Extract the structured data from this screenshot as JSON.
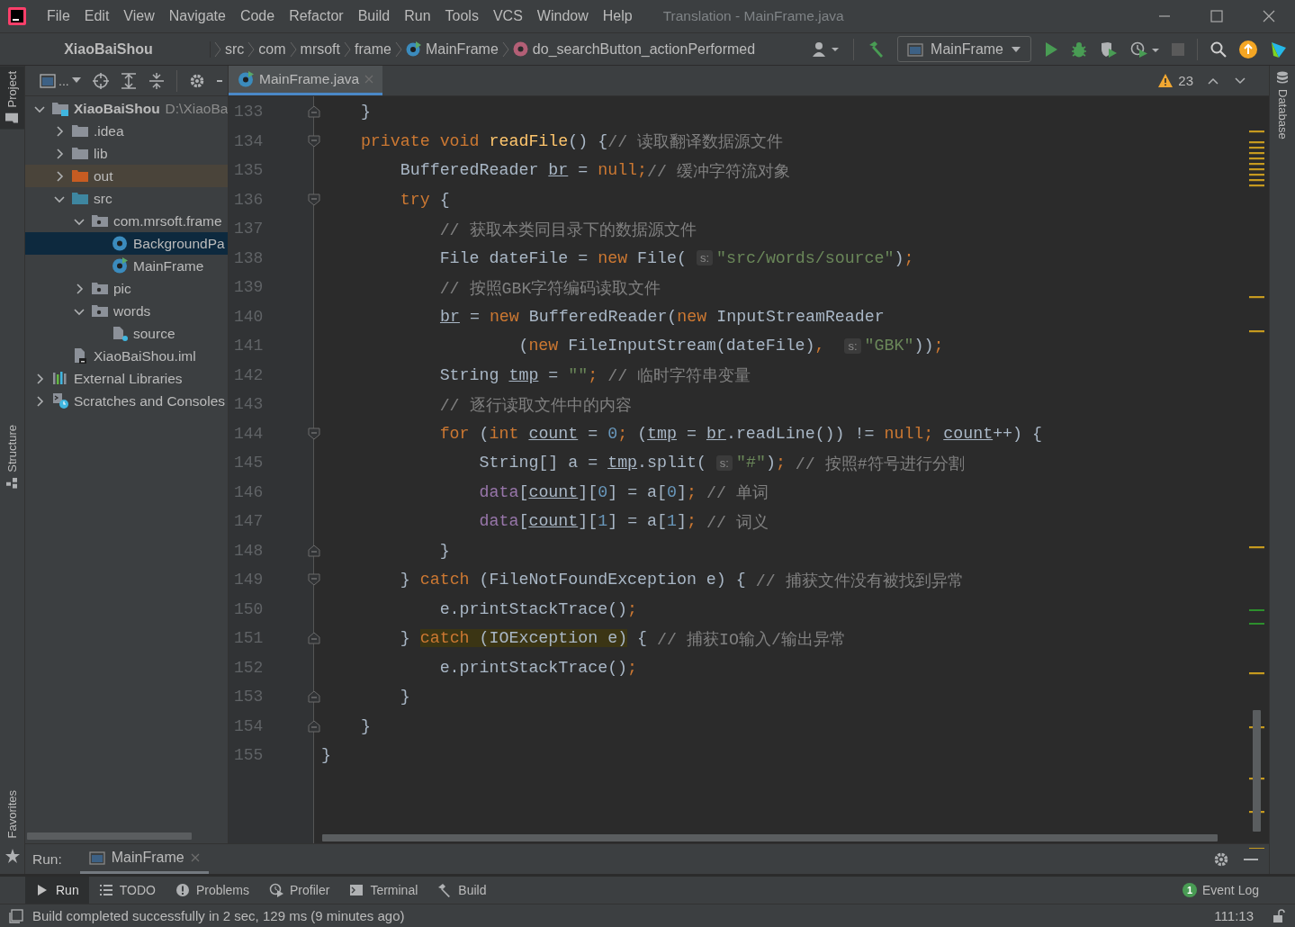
{
  "window": {
    "title": "Translation - MainFrame.java"
  },
  "menu": [
    "File",
    "Edit",
    "View",
    "Navigate",
    "Code",
    "Refactor",
    "Build",
    "Run",
    "Tools",
    "VCS",
    "Window",
    "Help"
  ],
  "breadcrumbs": [
    {
      "kind": "project",
      "text": "XiaoBaiShou"
    },
    {
      "kind": "plain",
      "text": "src"
    },
    {
      "kind": "plain",
      "text": "com"
    },
    {
      "kind": "plain",
      "text": "mrsoft"
    },
    {
      "kind": "plain",
      "text": "frame"
    },
    {
      "kind": "class",
      "text": "MainFrame"
    },
    {
      "kind": "method",
      "text": "do_searchButton_actionPerformed"
    }
  ],
  "run_config": {
    "value": "MainFrame"
  },
  "left_tabs": [
    {
      "label": "Project",
      "selected": true
    },
    {
      "label": "Structure",
      "selected": false
    },
    {
      "label": "Favorites",
      "selected": false
    }
  ],
  "right_tabs": [
    {
      "label": "Database",
      "selected": false
    }
  ],
  "project_toolbar": {
    "view_label": "..."
  },
  "project_tree": [
    {
      "kind": "module",
      "text": "XiaoBaiShou",
      "path": "D:\\XiaoBa",
      "expanded": true,
      "selected": false,
      "children": [
        {
          "kind": "folder",
          "text": ".idea",
          "expanded": false,
          "selected": false
        },
        {
          "kind": "folder",
          "text": "lib",
          "expanded": false,
          "selected": false
        },
        {
          "kind": "excluded",
          "text": "out",
          "expanded": false,
          "selected": false
        },
        {
          "kind": "source",
          "text": "src",
          "expanded": true,
          "selected": false,
          "children": [
            {
              "kind": "package",
              "text": "com.mrsoft.frame",
              "expanded": true,
              "selected": false,
              "children": [
                {
                  "kind": "class",
                  "text": "BackgroundPa",
                  "selected": true
                },
                {
                  "kind": "runclass",
                  "text": "MainFrame",
                  "selected": false
                }
              ]
            },
            {
              "kind": "package",
              "text": "pic",
              "expanded": false,
              "selected": false
            },
            {
              "kind": "package",
              "text": "words",
              "expanded": true,
              "selected": false,
              "children": [
                {
                  "kind": "unknown",
                  "text": "source",
                  "selected": false
                }
              ]
            }
          ]
        },
        {
          "kind": "iml",
          "text": "XiaoBaiShou.iml",
          "selected": false
        }
      ]
    },
    {
      "kind": "libraries",
      "text": "External Libraries",
      "expanded": false,
      "selected": false
    },
    {
      "kind": "scratches",
      "text": "Scratches and Consoles",
      "expanded": false,
      "selected": false
    }
  ],
  "editor_tabs": [
    {
      "label": "MainFrame.java",
      "selected": true
    }
  ],
  "inspections": {
    "warnings": "23"
  },
  "code_lines": [
    {
      "number": "133",
      "kind": "foldend",
      "tokens": [
        {
          "kind": "plain",
          "text": "    }"
        }
      ]
    },
    {
      "number": "134",
      "kind": "foldstart",
      "tokens": [
        {
          "kind": "keyword",
          "text": "    private void "
        },
        {
          "kind": "method",
          "text": "readFile"
        },
        {
          "kind": "plain",
          "text": "() {"
        },
        {
          "kind": "comment",
          "text": "// 读取翻译数据源文件"
        }
      ]
    },
    {
      "number": "135",
      "kind": "plain",
      "tokens": [
        {
          "kind": "plain",
          "text": "        BufferedReader "
        },
        {
          "kind": "variable",
          "text": "br"
        },
        {
          "kind": "plain",
          "text": " = "
        },
        {
          "kind": "keyword",
          "text": "null;"
        },
        {
          "kind": "comment",
          "text": "// 缓冲字符流对象"
        }
      ]
    },
    {
      "number": "136",
      "kind": "foldstart",
      "tokens": [
        {
          "kind": "keyword",
          "text": "        try"
        },
        {
          "kind": "plain",
          "text": " {"
        }
      ]
    },
    {
      "number": "137",
      "kind": "plain",
      "tokens": [
        {
          "kind": "comment",
          "text": "            // 获取本类同目录下的数据源文件"
        }
      ]
    },
    {
      "number": "138",
      "kind": "plain",
      "tokens": [
        {
          "kind": "plain",
          "text": "            File dateFile = "
        },
        {
          "kind": "keyword",
          "text": "new"
        },
        {
          "kind": "plain",
          "text": " File( "
        },
        {
          "kind": "hint",
          "text": "s:"
        },
        {
          "kind": "string",
          "text": "\"src/words/source\""
        },
        {
          "kind": "plain",
          "text": ")"
        },
        {
          "kind": "keyword",
          "text": ";"
        }
      ]
    },
    {
      "number": "139",
      "kind": "plain",
      "tokens": [
        {
          "kind": "comment",
          "text": "            // 按照GBK字符编码读取文件"
        }
      ]
    },
    {
      "number": "140",
      "kind": "plain",
      "tokens": [
        {
          "kind": "variable",
          "text": "br"
        },
        {
          "kind": "plain",
          "text": " = "
        },
        {
          "kind": "keyword",
          "text": "new"
        },
        {
          "kind": "plain",
          "text": " BufferedReader("
        },
        {
          "kind": "keyword",
          "text": "new"
        },
        {
          "kind": "plain",
          "text": " InputStreamReader"
        }
      ]
    },
    {
      "number": "141",
      "kind": "plain",
      "tokens": [
        {
          "kind": "plain",
          "text": "                    ("
        },
        {
          "kind": "keyword",
          "text": "new"
        },
        {
          "kind": "plain",
          "text": " FileInputStream(dateFile)"
        },
        {
          "kind": "keyword",
          "text": ",  "
        },
        {
          "kind": "hint",
          "text": "s:"
        },
        {
          "kind": "string",
          "text": "\"GBK\""
        },
        {
          "kind": "plain",
          "text": "))"
        },
        {
          "kind": "keyword",
          "text": ";"
        }
      ]
    },
    {
      "number": "142",
      "kind": "plain",
      "tokens": [
        {
          "kind": "plain",
          "text": "            String "
        },
        {
          "kind": "variable",
          "text": "tmp"
        },
        {
          "kind": "plain",
          "text": " = "
        },
        {
          "kind": "string",
          "text": "\"\""
        },
        {
          "kind": "keyword",
          "text": ";"
        },
        {
          "kind": "comment",
          "text": " // 临时字符串变量"
        }
      ]
    },
    {
      "number": "143",
      "kind": "plain",
      "tokens": [
        {
          "kind": "comment",
          "text": "            // 逐行读取文件中的内容"
        }
      ]
    },
    {
      "number": "144",
      "kind": "foldstart",
      "tokens": [
        {
          "kind": "keyword",
          "text": "            for"
        },
        {
          "kind": "plain",
          "text": " ("
        },
        {
          "kind": "keyword",
          "text": "int "
        },
        {
          "kind": "variable",
          "text": "count"
        },
        {
          "kind": "plain",
          "text": " = "
        },
        {
          "kind": "number",
          "text": "0"
        },
        {
          "kind": "keyword",
          "text": ";"
        },
        {
          "kind": "plain",
          "text": " ("
        },
        {
          "kind": "variable",
          "text": "tmp"
        },
        {
          "kind": "plain",
          "text": " = "
        },
        {
          "kind": "variable",
          "text": "br"
        },
        {
          "kind": "plain",
          "text": ".readLine()) != "
        },
        {
          "kind": "keyword",
          "text": "null; "
        },
        {
          "kind": "variable",
          "text": "count"
        },
        {
          "kind": "plain",
          "text": "++) {"
        }
      ]
    },
    {
      "number": "145",
      "kind": "plain",
      "tokens": [
        {
          "kind": "plain",
          "text": "                String[] a = "
        },
        {
          "kind": "variable",
          "text": "tmp"
        },
        {
          "kind": "plain",
          "text": ".split( "
        },
        {
          "kind": "hint",
          "text": "s:"
        },
        {
          "kind": "string",
          "text": "\"#\""
        },
        {
          "kind": "plain",
          "text": ")"
        },
        {
          "kind": "keyword",
          "text": ";"
        },
        {
          "kind": "comment",
          "text": " // 按照#符号进行分割"
        }
      ]
    },
    {
      "number": "146",
      "kind": "plain",
      "tokens": [
        {
          "kind": "field",
          "text": "                data"
        },
        {
          "kind": "plain",
          "text": "["
        },
        {
          "kind": "variable",
          "text": "count"
        },
        {
          "kind": "plain",
          "text": "]["
        },
        {
          "kind": "number",
          "text": "0"
        },
        {
          "kind": "plain",
          "text": "] = a["
        },
        {
          "kind": "number",
          "text": "0"
        },
        {
          "kind": "plain",
          "text": "]"
        },
        {
          "kind": "keyword",
          "text": ";"
        },
        {
          "kind": "comment",
          "text": " // 单词"
        }
      ]
    },
    {
      "number": "147",
      "kind": "plain",
      "tokens": [
        {
          "kind": "field",
          "text": "                data"
        },
        {
          "kind": "plain",
          "text": "["
        },
        {
          "kind": "variable",
          "text": "count"
        },
        {
          "kind": "plain",
          "text": "]["
        },
        {
          "kind": "number",
          "text": "1"
        },
        {
          "kind": "plain",
          "text": "] = a["
        },
        {
          "kind": "number",
          "text": "1"
        },
        {
          "kind": "plain",
          "text": "]"
        },
        {
          "kind": "keyword",
          "text": ";"
        },
        {
          "kind": "comment",
          "text": " // 词义"
        }
      ]
    },
    {
      "number": "148",
      "kind": "foldend",
      "tokens": [
        {
          "kind": "plain",
          "text": "            }"
        }
      ]
    },
    {
      "number": "149",
      "kind": "foldstart",
      "tokens": [
        {
          "kind": "plain",
          "text": "        } "
        },
        {
          "kind": "keyword",
          "text": "catch"
        },
        {
          "kind": "plain",
          "text": " (FileNotFoundException e) { "
        },
        {
          "kind": "comment",
          "text": "// 捕获文件没有被找到异常"
        }
      ]
    },
    {
      "number": "150",
      "kind": "plain",
      "tokens": [
        {
          "kind": "plain",
          "text": "            e.printStackTrace()"
        },
        {
          "kind": "keyword",
          "text": ";"
        }
      ]
    },
    {
      "number": "151",
      "kind": "foldend",
      "tokens": [
        {
          "kind": "plain",
          "text": "        } "
        },
        {
          "kind": "matchkeyword",
          "text": "catch"
        },
        {
          "kind": "match",
          "text": " (IOException e)"
        },
        {
          "kind": "plain",
          "text": " { "
        },
        {
          "kind": "comment",
          "text": "// 捕获IO输入/输出异常"
        }
      ]
    },
    {
      "number": "152",
      "kind": "plain",
      "tokens": [
        {
          "kind": "plain",
          "text": "            e.printStackTrace()"
        },
        {
          "kind": "keyword",
          "text": ";"
        }
      ]
    },
    {
      "number": "153",
      "kind": "foldend",
      "tokens": [
        {
          "kind": "plain",
          "text": "        }"
        }
      ]
    },
    {
      "number": "154",
      "kind": "foldend",
      "tokens": [
        {
          "kind": "plain",
          "text": "    }"
        }
      ]
    },
    {
      "number": "155",
      "kind": "plain",
      "tokens": [
        {
          "kind": "plain",
          "text": "}"
        }
      ]
    }
  ],
  "run_panel": {
    "label": "Run:",
    "tabs": [
      {
        "label": "MainFrame",
        "selected": true
      }
    ]
  },
  "tool_tabs": [
    {
      "kind": "run",
      "label": "Run",
      "selected": true
    },
    {
      "kind": "todo",
      "label": "TODO",
      "selected": false
    },
    {
      "kind": "problems",
      "label": "Problems",
      "selected": false
    },
    {
      "kind": "profiler",
      "label": "Profiler",
      "selected": false
    },
    {
      "kind": "terminal",
      "label": "Terminal",
      "selected": false
    },
    {
      "kind": "build",
      "label": "Build",
      "selected": false
    }
  ],
  "event_log": {
    "badge": "1",
    "label": "Event Log"
  },
  "status_bar": {
    "message": "Build completed successfully in 2 sec, 129 ms (9 minutes ago)",
    "position": "111:13"
  }
}
